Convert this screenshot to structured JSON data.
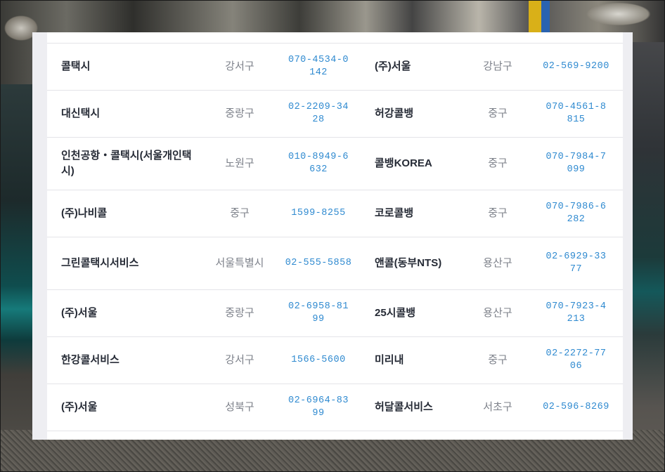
{
  "rows": [
    {
      "left": {
        "name": "콜택시",
        "district": "강서구",
        "phone": "070-4534-0142"
      },
      "right": {
        "name": "(주)서울",
        "district": "강남구",
        "phone": "02-569-9200"
      }
    },
    {
      "left": {
        "name": "대신택시",
        "district": "중랑구",
        "phone": "02-2209-3428"
      },
      "right": {
        "name": "허강콜뱅",
        "district": "중구",
        "phone": "070-4561-8815"
      }
    },
    {
      "left": {
        "name": "인천공항・콜택시(서울개인택시)",
        "district": "노원구",
        "phone": "010-8949-6632"
      },
      "right": {
        "name": "콜뱅KOREA",
        "district": "중구",
        "phone": "070-7984-7099"
      }
    },
    {
      "left": {
        "name": "(주)나비콜",
        "district": "중구",
        "phone": "1599-8255"
      },
      "right": {
        "name": "코로콜뱅",
        "district": "중구",
        "phone": "070-7986-6282"
      }
    },
    {
      "left": {
        "name": "그린콜택시서비스",
        "district": "서울특별시",
        "phone": "02-555-5858"
      },
      "right": {
        "name": "앤콜(동부NTS)",
        "district": "용산구",
        "phone": "02-6929-3377"
      }
    },
    {
      "left": {
        "name": "(주)서울",
        "district": "중랑구",
        "phone": "02-6958-8199"
      },
      "right": {
        "name": "25시콜뱅",
        "district": "용산구",
        "phone": "070-7923-4213"
      }
    },
    {
      "left": {
        "name": "한강콜서비스",
        "district": "강서구",
        "phone": "1566-5600"
      },
      "right": {
        "name": "미리내",
        "district": "중구",
        "phone": "02-2272-7706"
      }
    },
    {
      "left": {
        "name": "(주)서울",
        "district": "성북구",
        "phone": "02-6964-8399"
      },
      "right": {
        "name": "허달콜서비스",
        "district": "서초구",
        "phone": "02-596-8269"
      }
    }
  ],
  "colors": {
    "accent_phone": "#2f8ad0",
    "name_text": "#252a35",
    "district_text": "#7d818a"
  }
}
